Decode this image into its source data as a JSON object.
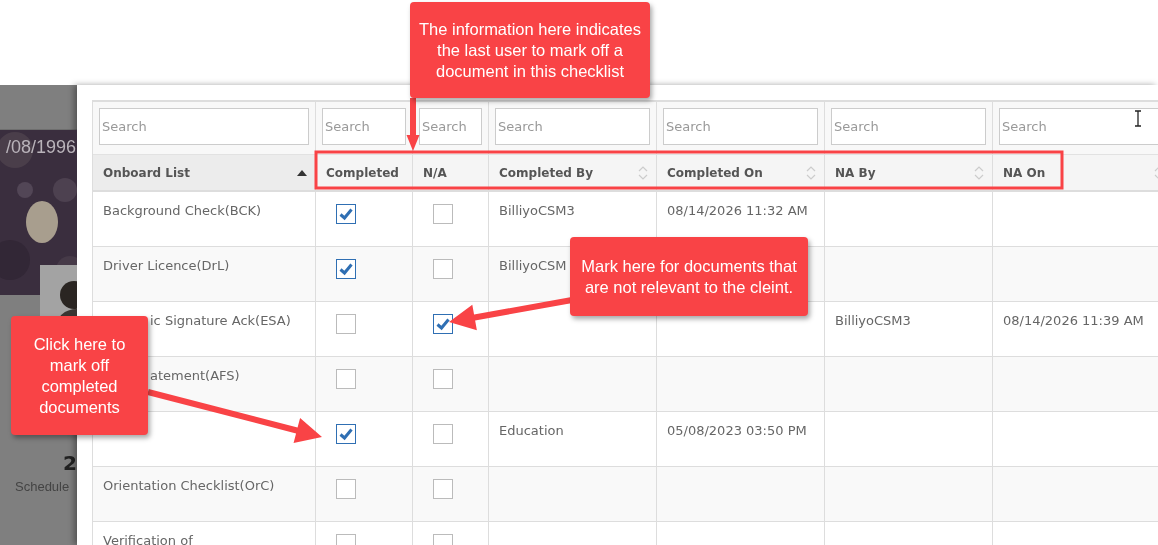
{
  "backdrop": {
    "date": "/08/1996",
    "count": "2",
    "caption": "Schedule"
  },
  "table": {
    "columns": [
      {
        "label": "Onboard List",
        "sorted": true,
        "placeholder": "Search"
      },
      {
        "label": "Completed",
        "sorted": false,
        "sortable": false,
        "placeholder": "Search"
      },
      {
        "label": "N/A",
        "sorted": false,
        "sortable": false,
        "placeholder": "Search"
      },
      {
        "label": "Completed By",
        "sorted": false,
        "sortable": true,
        "placeholder": "Search"
      },
      {
        "label": "Completed On",
        "sorted": false,
        "sortable": true,
        "placeholder": "Search"
      },
      {
        "label": "NA By",
        "sorted": false,
        "sortable": true,
        "placeholder": "Search"
      },
      {
        "label": "NA On",
        "sorted": false,
        "sortable": true,
        "placeholder": "Search"
      }
    ],
    "rows": [
      {
        "name": "Background Check(BCK)",
        "start_hidden": false,
        "completed": true,
        "na": false,
        "completed_by": "BilliyoCSM3",
        "completed_on": "08/14/2026 11:32 AM"
      },
      {
        "name": "Driver Licence(DrL)",
        "start_hidden": false,
        "completed": true,
        "na": false,
        "completed_by": "BilliyoCSM"
      },
      {
        "name": "ic Signature Ack(ESA)",
        "start_hidden": true,
        "completed": false,
        "na": true,
        "na_by": "BilliyoCSM3",
        "na_on": "08/14/2026 11:39 AM"
      },
      {
        "name": "atement(AFS)",
        "start_hidden": true,
        "completed": false,
        "na": false
      },
      {
        "start_hidden": true,
        "completed": true,
        "na": false,
        "completed_by": "Education",
        "completed_on": "05/08/2023 03:50 PM"
      },
      {
        "name": "Orientation Checklist(OrC)",
        "start_hidden": false,
        "completed": false,
        "na": false
      },
      {
        "name": "Verification of",
        "start_hidden": false,
        "completed": false,
        "na": false
      }
    ]
  },
  "callouts": [
    {
      "kind": "top",
      "text": "The information here indicates the last user to mark off a document in this checklist"
    },
    {
      "kind": "right",
      "text": "Mark here for documents that are not relevant to the cleint."
    },
    {
      "kind": "left",
      "text": "Click here to mark off completed documents"
    }
  ]
}
